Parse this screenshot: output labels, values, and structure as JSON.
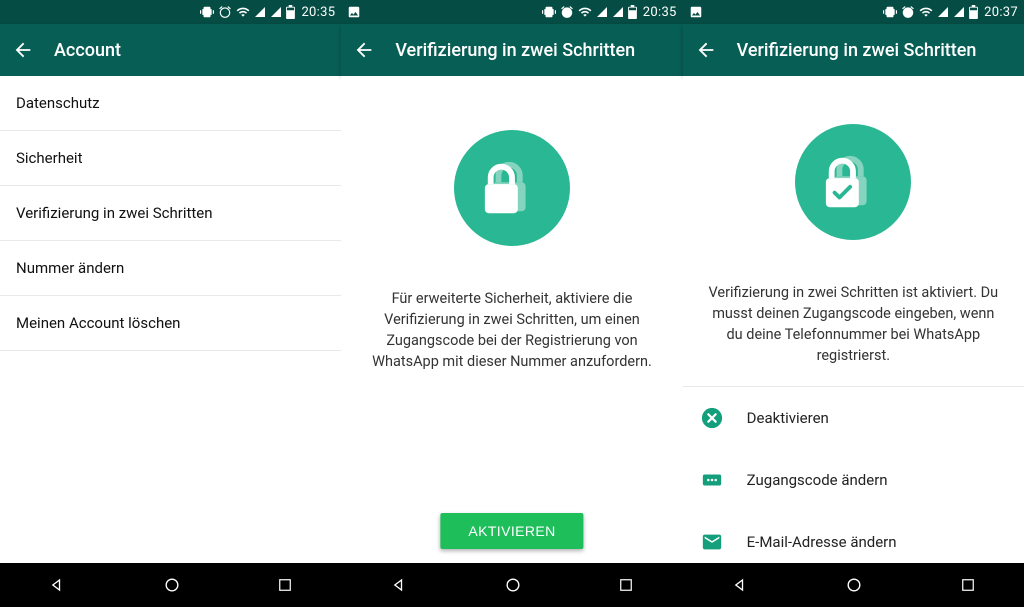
{
  "accent": "#075E54",
  "circle": "#2AB793",
  "screens": [
    {
      "time": "20:35",
      "title": "Account",
      "type": "list",
      "items": [
        "Datenschutz",
        "Sicherheit",
        "Verifizierung in zwei Schritten",
        "Nummer ändern",
        "Meinen Account löschen"
      ]
    },
    {
      "time": "20:35",
      "title": "Verifizierung in zwei Schritten",
      "type": "hero",
      "description": "Für erweiterte Sicherheit, aktiviere die Verifizierung in zwei Schritten, um einen Zugangscode bei der Registrierung von WhatsApp mit dieser Nummer anzufordern.",
      "cta": "AKTIVIEREN"
    },
    {
      "time": "20:37",
      "title": "Verifizierung in zwei Schritten",
      "type": "active",
      "description": "Verifizierung in zwei Schritten ist aktiviert. Du musst deinen Zugangscode eingeben, wenn du deine Telefonnummer bei WhatsApp registrierst.",
      "options": {
        "deactivate": "Deaktivieren",
        "change_code": "Zugangscode ändern",
        "change_email": "E-Mail-Adresse ändern"
      }
    }
  ]
}
